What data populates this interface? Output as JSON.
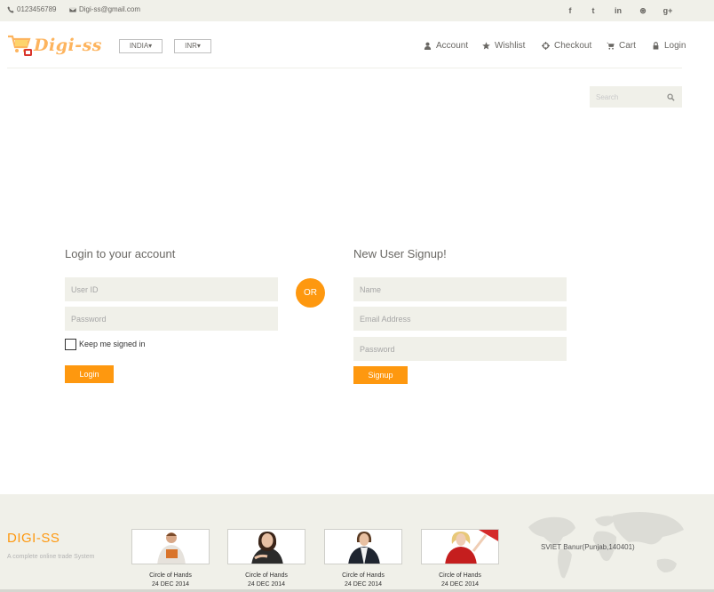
{
  "topbar": {
    "phone": "0123456789",
    "email": "Digi-ss@gmail.com",
    "social": [
      {
        "icon": "facebook-icon",
        "glyph": "f"
      },
      {
        "icon": "twitter-icon",
        "glyph": "t"
      },
      {
        "icon": "linkedin-icon",
        "glyph": "in"
      },
      {
        "icon": "dribbble-icon",
        "glyph": "⊛"
      },
      {
        "icon": "google-plus-icon",
        "glyph": "g+"
      }
    ]
  },
  "header": {
    "logo_text": "Digi-ss",
    "country": "INDIA",
    "currency": "INR",
    "nav": {
      "account": "Account",
      "wishlist": "Wishlist",
      "checkout": "Checkout",
      "cart": "Cart",
      "login": "Login"
    }
  },
  "search": {
    "placeholder": "Search"
  },
  "login_form": {
    "title": "Login to your account",
    "userid_placeholder": "User ID",
    "password_placeholder": "Password",
    "keep_signed_in": "Keep me signed in",
    "button": "Login"
  },
  "or_label": "OR",
  "signup_form": {
    "title": "New User Signup!",
    "name_placeholder": "Name",
    "email_placeholder": "Email Address",
    "password_placeholder": "Password",
    "button": "Signup"
  },
  "footer": {
    "brand": "DIGI-SS",
    "tagline": "A complete online trade System",
    "videos": [
      {
        "title": "Circle of Hands",
        "date": "24 DEC 2014"
      },
      {
        "title": "Circle of Hands",
        "date": "24 DEC 2014"
      },
      {
        "title": "Circle of Hands",
        "date": "24 DEC 2014"
      },
      {
        "title": "Circle of Hands",
        "date": "24 DEC 2014"
      }
    ],
    "address": "SVIET Banur(Punjab,140401)"
  },
  "colors": {
    "accent": "#fe980f",
    "panel": "#f0f0e9",
    "text": "#696763"
  }
}
